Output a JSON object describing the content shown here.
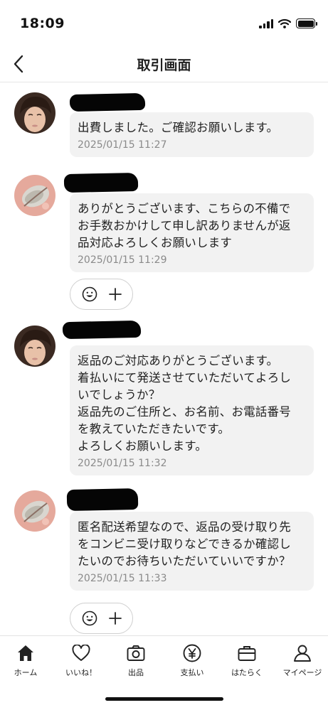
{
  "status_bar": {
    "time": "18:09"
  },
  "header": {
    "title": "取引画面"
  },
  "messages": [
    {
      "text": "出費しました。ご確認お願いします。",
      "timestamp": "2025/01/15 11:27"
    },
    {
      "text": "ありがとうございます、こちらの不備で\nお手数おかけして申し訳ありませんが返\n品対応よろしくお願いします",
      "timestamp": "2025/01/15 11:29"
    },
    {
      "text": "返品のご対応ありがとうございます。\n着払いにて発送させていただいてよろし\nいでしょうか？\n返品先のご住所と、お名前、お電話番号\nを教えていただきたいです。\nよろしくお願いします。",
      "timestamp": "2025/01/15 11:32"
    },
    {
      "text": "匿名配送希望なので、返品の受け取り先\nをコンビニ受け取りなどできるか確認し\nたいのでお待ちいただいていいですか？",
      "timestamp": "2025/01/15 11:33"
    }
  ],
  "tab_bar": {
    "items": [
      {
        "label": "ホーム",
        "icon": "home-icon"
      },
      {
        "label": "いいね！",
        "icon": "heart-icon"
      },
      {
        "label": "出品",
        "icon": "camera-icon"
      },
      {
        "label": "支払い",
        "icon": "yen-icon"
      },
      {
        "label": "はたらく",
        "icon": "briefcase-icon"
      },
      {
        "label": "マイページ",
        "icon": "person-icon"
      }
    ]
  }
}
